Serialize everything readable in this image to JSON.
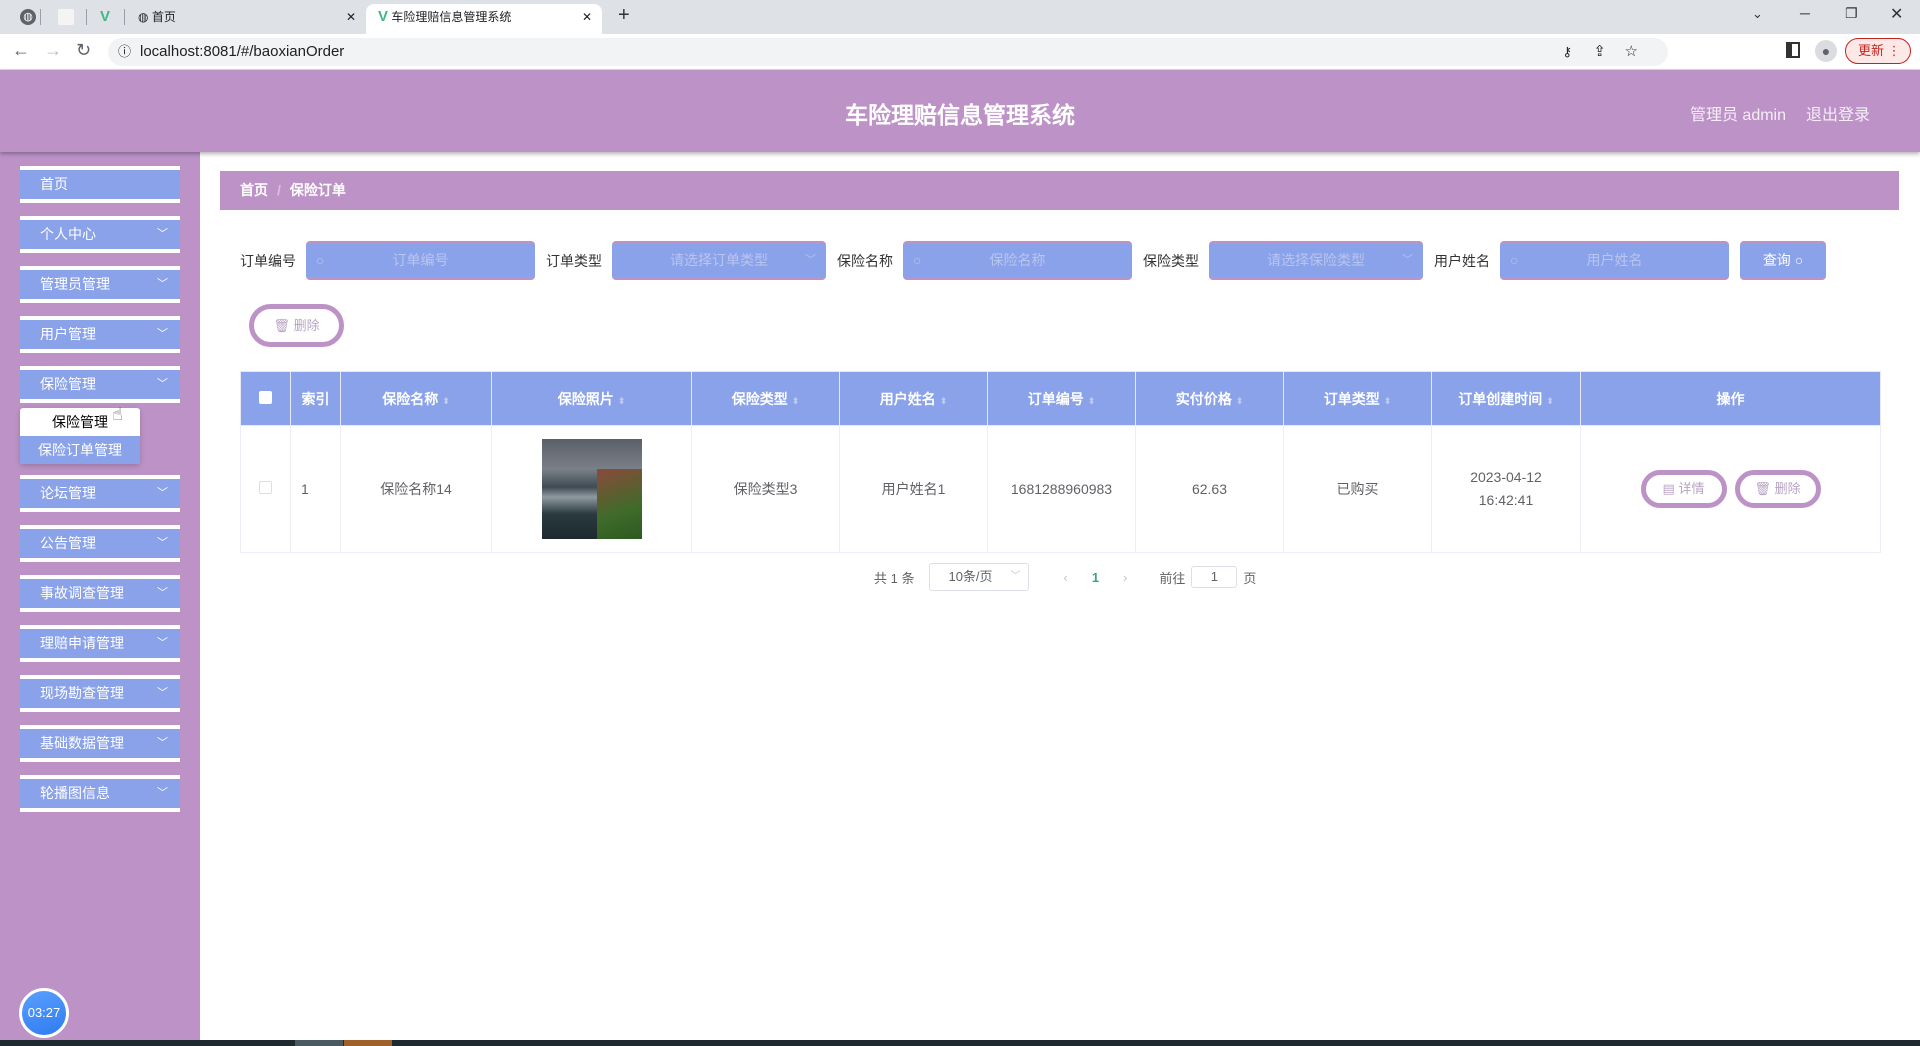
{
  "browser": {
    "tabs": [
      {
        "label": "首页"
      },
      {
        "label": "车险理赔信息管理系统"
      }
    ],
    "url": "localhost:8081/#/baoxianOrder",
    "update_label": "更新"
  },
  "header": {
    "title": "车险理赔信息管理系统",
    "user": "管理员 admin",
    "logout": "退出登录"
  },
  "sidebar": {
    "items": [
      {
        "label": "首页"
      },
      {
        "label": "个人中心"
      },
      {
        "label": "管理员管理"
      },
      {
        "label": "用户管理"
      },
      {
        "label": "保险管理"
      },
      {
        "label": "论坛管理"
      },
      {
        "label": "公告管理"
      },
      {
        "label": "事故调查管理"
      },
      {
        "label": "理赔申请管理"
      },
      {
        "label": "现场勘查管理"
      },
      {
        "label": "基础数据管理"
      },
      {
        "label": "轮播图信息"
      }
    ],
    "submenu": [
      {
        "label": "保险管理"
      },
      {
        "label": "保险订单管理"
      }
    ]
  },
  "clock": "03:27",
  "breadcrumb": {
    "home": "首页",
    "current": "保险订单"
  },
  "search": {
    "order_no_label": "订单编号",
    "order_no_placeholder": "订单编号",
    "order_type_label": "订单类型",
    "order_type_placeholder": "请选择订单类型",
    "ins_name_label": "保险名称",
    "ins_name_placeholder": "保险名称",
    "ins_type_label": "保险类型",
    "ins_type_placeholder": "请选择保险类型",
    "user_label": "用户姓名",
    "user_placeholder": "用户姓名",
    "query": "查询"
  },
  "delete_label": "删除",
  "table": {
    "headers": [
      "索引",
      "保险名称",
      "保险照片",
      "保险类型",
      "用户姓名",
      "订单编号",
      "实付价格",
      "订单类型",
      "订单创建时间",
      "操作"
    ],
    "rows": [
      {
        "index": "1",
        "name": "保险名称14",
        "type": "保险类型3",
        "user": "用户姓名1",
        "order_no": "1681288960983",
        "price": "62.63",
        "order_type": "已购买",
        "created": "2023-04-12 16:42:41"
      }
    ],
    "detail_label": "详情",
    "delete_label": "删除"
  },
  "pagination": {
    "total": "共 1 条",
    "page_size": "10条/页",
    "current": "1",
    "goto_label": "前往",
    "goto_value": "1",
    "page_suffix": "页"
  }
}
